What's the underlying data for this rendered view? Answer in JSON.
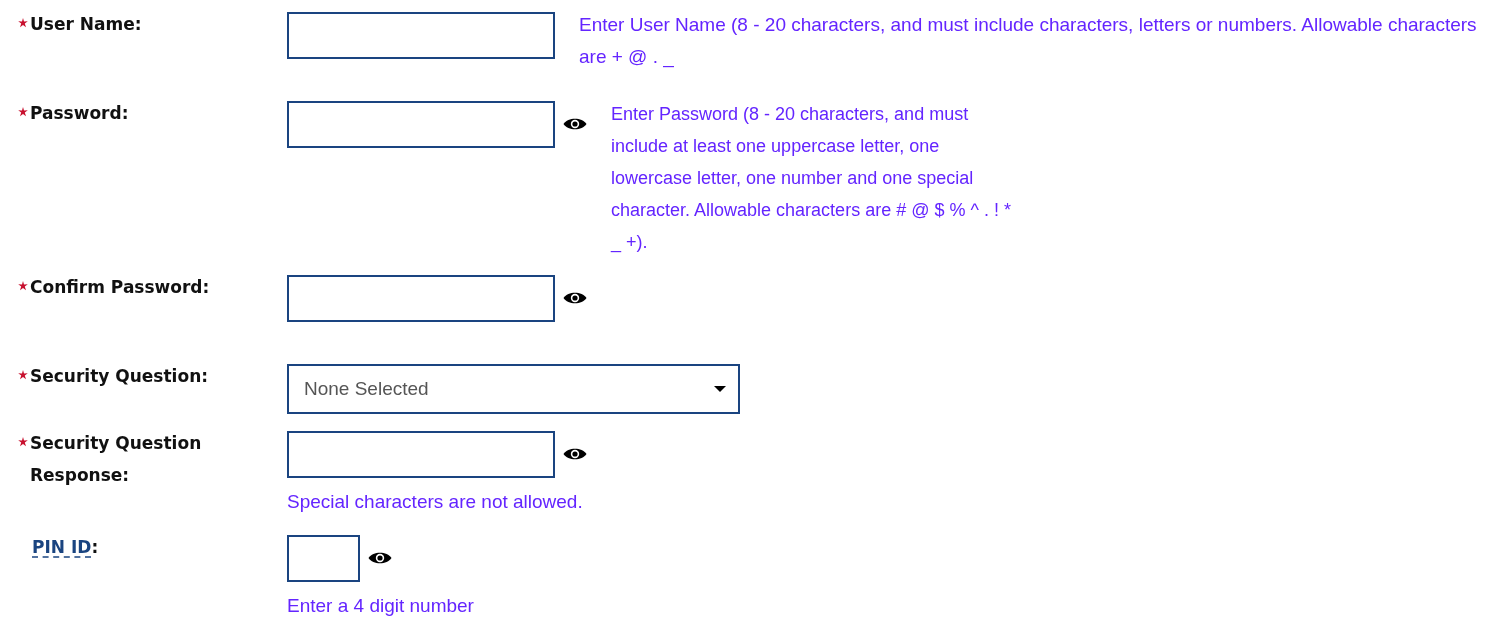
{
  "fields": [
    {
      "kind": "text",
      "label": "User Name:",
      "required": true,
      "reveal": false,
      "hint": "Enter User Name (8 - 20 characters, and must include characters, letters or numbers. Allowable characters are + @ . _"
    },
    {
      "kind": "text",
      "label": "Password:",
      "required": true,
      "reveal": true,
      "hint": "Enter Password (8 - 20 characters, and must include at least one uppercase letter, one lowercase letter, one number and one special character. Allowable characters are # @ $ % ^ . ! * _ +)."
    },
    {
      "kind": "text",
      "label": "Confirm Password:",
      "required": true,
      "reveal": true
    },
    {
      "kind": "select",
      "label": "Security Question:",
      "required": true,
      "value": "None Selected"
    },
    {
      "kind": "text",
      "label": "Security Question Response:",
      "required": true,
      "reveal": true,
      "note": "Special characters are not allowed."
    },
    {
      "kind": "short",
      "label": "PIN ID",
      "label_end": ":",
      "abbr": true,
      "required": false,
      "reveal": true,
      "note": "Enter a 4 digit number"
    }
  ]
}
